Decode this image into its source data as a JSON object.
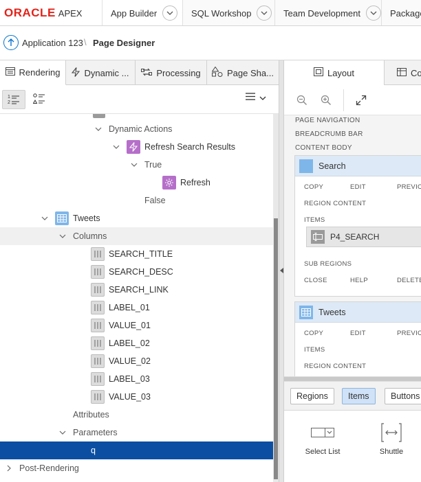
{
  "topnav": {
    "logo_brand": "ORACLE",
    "logo_product": "APEX",
    "tabs": [
      {
        "label": "App Builder"
      },
      {
        "label": "SQL Workshop"
      },
      {
        "label": "Team Development"
      },
      {
        "label": "Package"
      }
    ]
  },
  "breadcrumb": {
    "application": "Application 123",
    "separator": "\\",
    "page": "Page Designer"
  },
  "left_pane": {
    "tabs": [
      {
        "label": "Rendering",
        "icon": "rendering-icon"
      },
      {
        "label": "Dynamic ...",
        "icon": "lightning-icon"
      },
      {
        "label": "Processing",
        "icon": "processing-icon"
      },
      {
        "label": "Page Sha...",
        "icon": "shapes-icon"
      }
    ],
    "toolbar": {
      "view_order": "1 2",
      "view_component": "component-view-icon",
      "menu": "menu-icon"
    },
    "tree": [
      {
        "label": "Dynamic Actions"
      },
      {
        "label": "Refresh Search Results"
      },
      {
        "label": "True"
      },
      {
        "label": "Refresh"
      },
      {
        "label": "False"
      },
      {
        "label": "Tweets"
      },
      {
        "label": "Columns"
      },
      {
        "label": "SEARCH_TITLE"
      },
      {
        "label": "SEARCH_DESC"
      },
      {
        "label": "SEARCH_LINK"
      },
      {
        "label": "LABEL_01"
      },
      {
        "label": "VALUE_01"
      },
      {
        "label": "LABEL_02"
      },
      {
        "label": "VALUE_02"
      },
      {
        "label": "LABEL_03"
      },
      {
        "label": "VALUE_03"
      },
      {
        "label": "Attributes"
      },
      {
        "label": "Parameters"
      },
      {
        "label": "q"
      },
      {
        "label": "Post-Rendering"
      }
    ]
  },
  "right_pane": {
    "tabs": [
      {
        "label": "Layout"
      },
      {
        "label": "Co"
      }
    ],
    "layout": {
      "positions": {
        "page_navigation": "PAGE NAVIGATION",
        "breadcrumb_bar": "BREADCRUMB BAR",
        "content_body": "CONTENT BODY"
      },
      "regions": [
        {
          "name": "Search",
          "labels": {
            "copy": "COPY",
            "edit": "EDIT",
            "preview": "PREVIC",
            "region_content": "REGION CONTENT",
            "items": "ITEMS",
            "sub_regions": "SUB REGIONS",
            "close": "CLOSE",
            "help": "HELP",
            "delete": "DELETE"
          },
          "item": "P4_SEARCH"
        },
        {
          "name": "Tweets",
          "labels": {
            "copy": "COPY",
            "edit": "EDIT",
            "preview": "PREVIC",
            "items": "ITEMS",
            "region_content": "REGION CONTENT"
          }
        }
      ]
    },
    "gallery": {
      "tabs": [
        {
          "label": "Regions"
        },
        {
          "label": "Items"
        },
        {
          "label": "Buttons"
        }
      ],
      "items": [
        {
          "label": "Select List"
        },
        {
          "label": "Shuttle"
        }
      ]
    }
  }
}
